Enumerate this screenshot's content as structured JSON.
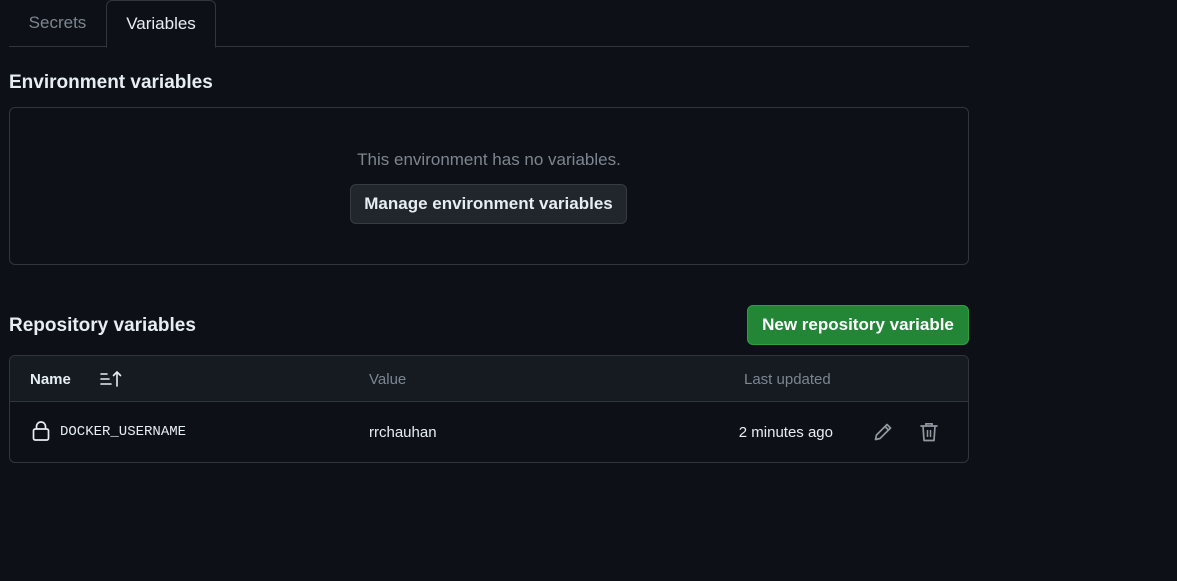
{
  "tabs": [
    {
      "label": "Secrets",
      "active": false
    },
    {
      "label": "Variables",
      "active": true
    }
  ],
  "environment": {
    "heading": "Environment variables",
    "empty_text": "This environment has no variables.",
    "manage_button": "Manage environment variables"
  },
  "repository": {
    "heading": "Repository variables",
    "new_button": "New repository variable",
    "table": {
      "columns": {
        "name": "Name",
        "value": "Value",
        "updated": "Last updated"
      },
      "rows": [
        {
          "name": "DOCKER_USERNAME",
          "value": "rrchauhan",
          "updated": "2 minutes ago"
        }
      ]
    }
  },
  "icons": {
    "sort": "sort-ascending-icon",
    "lock": "lock-icon",
    "edit": "pencil-icon",
    "delete": "trash-icon"
  },
  "colors": {
    "background": "#0d1117",
    "primary_button": "#238636",
    "border": "#30363d",
    "muted_text": "#7d8590"
  }
}
